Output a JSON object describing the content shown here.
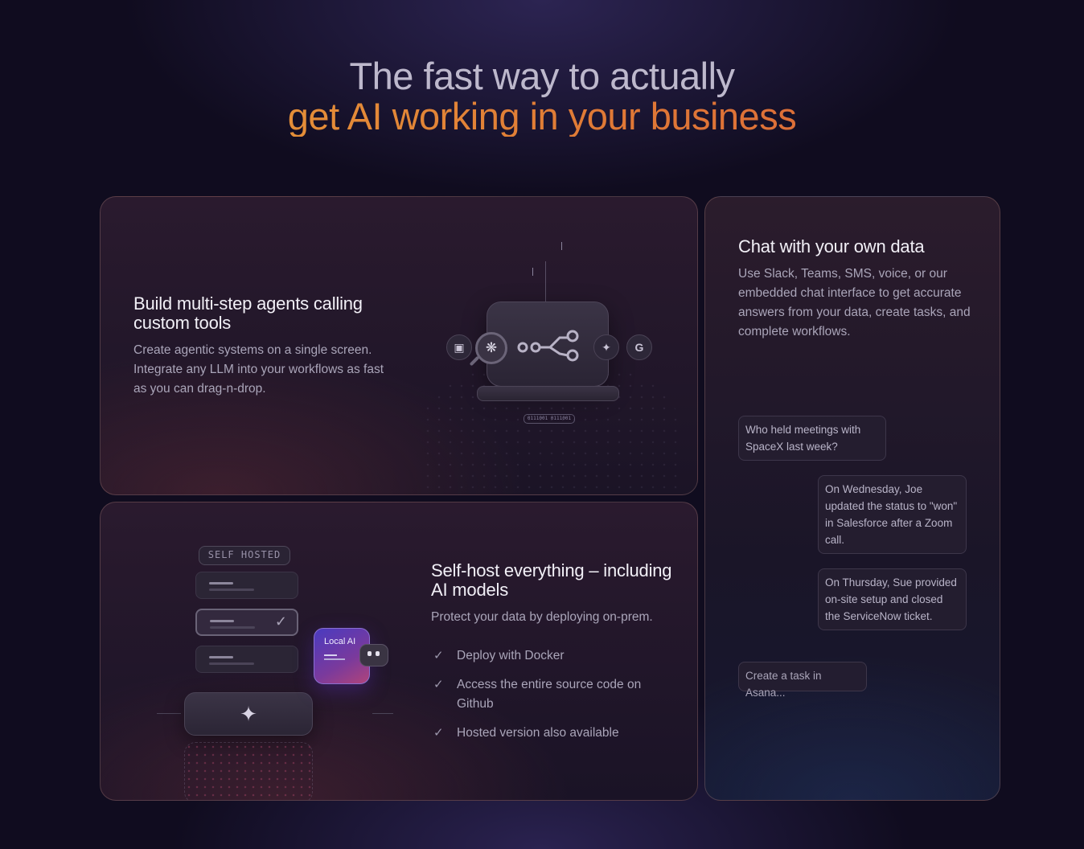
{
  "headline": {
    "line1": "The fast way to actually",
    "line2": "get AI working in your business"
  },
  "colors": {
    "background": "#100c1f",
    "accent_gradient_start": "#e8a13a",
    "accent_gradient_end": "#d8603a",
    "card_border": "#8a6a66"
  },
  "agents_card": {
    "title": "Build multi-step agents calling custom tools",
    "body": "Create agentic systems on a single screen. Integrate any LLM into your workflows as fast as you can drag-n-drop.",
    "icons": [
      "notion-icon",
      "openai-icon",
      "workflow-icon",
      "sparkle-icon",
      "google-icon"
    ],
    "binary_label": "0111001 0111001"
  },
  "chat_card": {
    "title": "Chat with your own data",
    "body": "Use Slack, Teams, SMS, voice, or our embedded chat interface to get accurate answers from your data, create tasks, and complete workflows.",
    "messages": [
      {
        "role": "user",
        "text": "Who held meetings with SpaceX last week?"
      },
      {
        "role": "assistant",
        "text": "On Wednesday, Joe updated the status to \"won\" in Salesforce after a Zoom call."
      },
      {
        "role": "assistant",
        "text": "On Thursday, Sue provided on-site setup and closed the ServiceNow ticket."
      }
    ],
    "input_placeholder": "Create a task in Asana..."
  },
  "self_card": {
    "title": "Self-host everything – including AI models",
    "body": "Protect your data by deploying on-prem.",
    "features": [
      "Deploy with Docker",
      "Access the entire source code on Github",
      "Hosted version also available"
    ],
    "badge": "SELF HOSTED",
    "local_ai_label": "Local AI"
  }
}
